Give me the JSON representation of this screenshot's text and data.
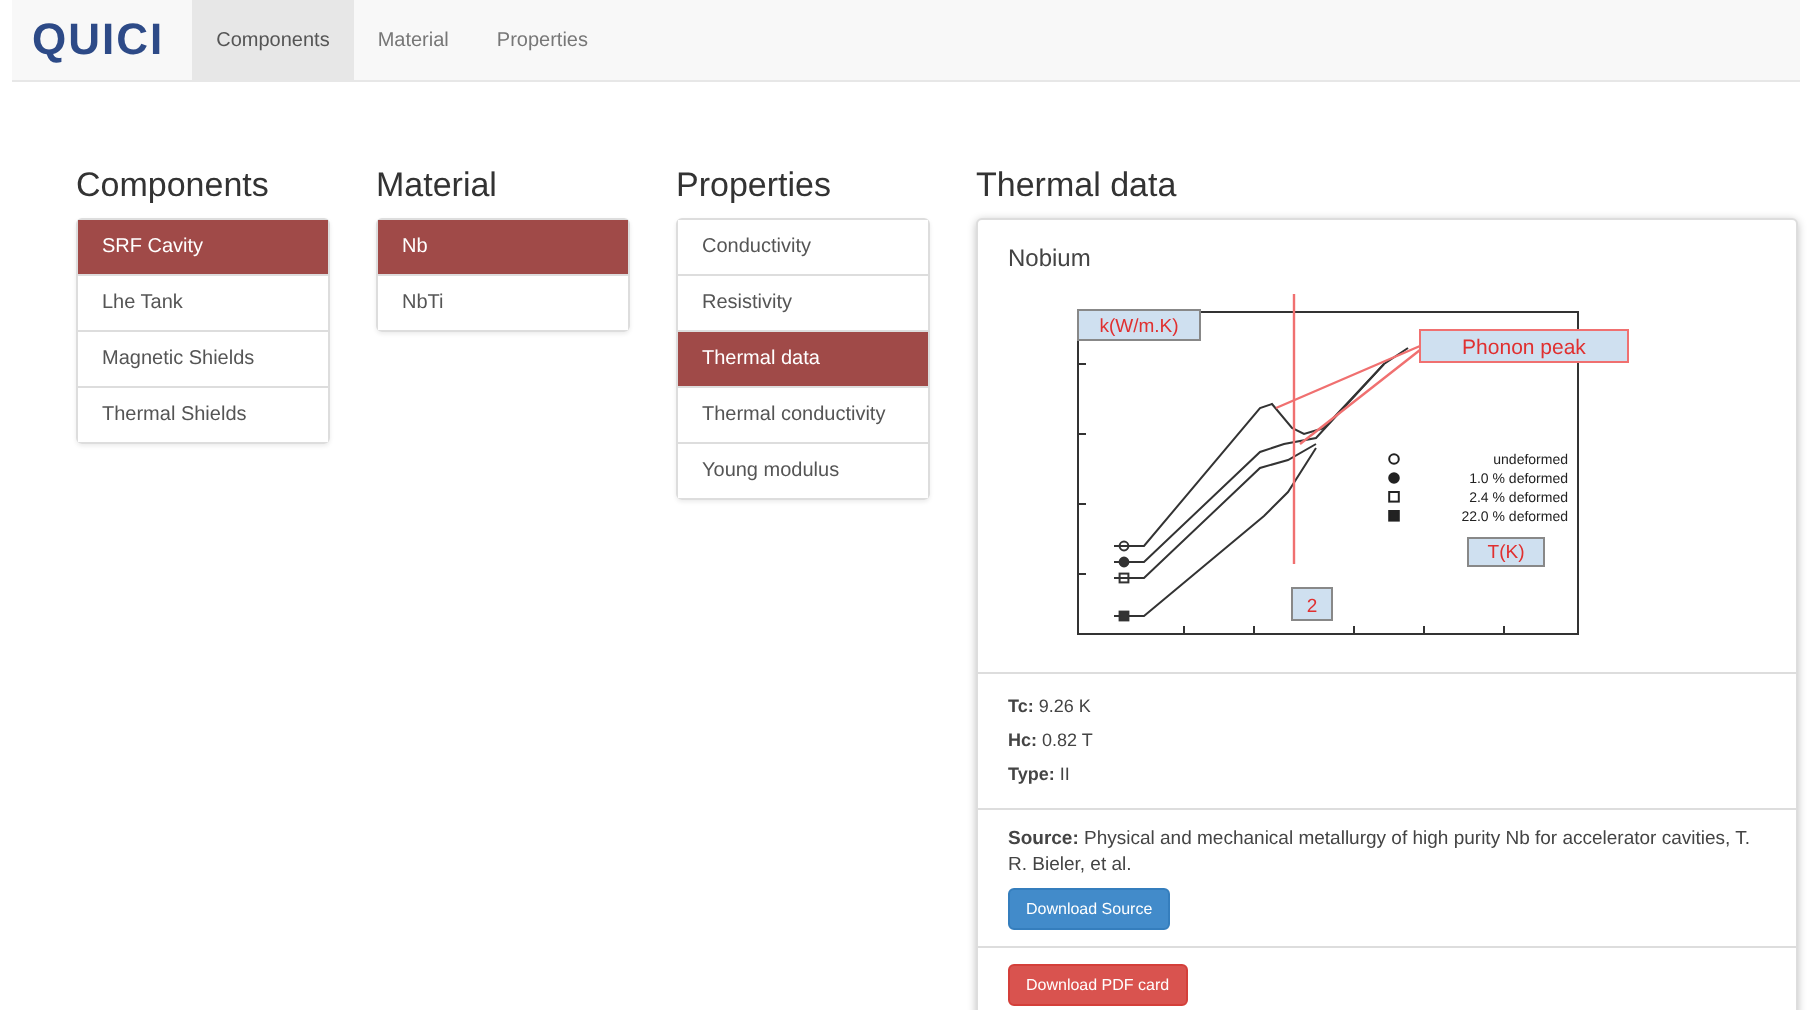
{
  "navbar": {
    "brand": "QUICI",
    "tabs": [
      {
        "label": "Components",
        "selected": true
      },
      {
        "label": "Material",
        "selected": false
      },
      {
        "label": "Properties",
        "selected": false
      }
    ]
  },
  "columns": [
    {
      "heading": "Components",
      "items": [
        {
          "label": "SRF Cavity",
          "selected": true
        },
        {
          "label": "Lhe Tank",
          "selected": false
        },
        {
          "label": "Magnetic Shields",
          "selected": false
        },
        {
          "label": "Thermal Shields",
          "selected": false
        }
      ]
    },
    {
      "heading": "Material",
      "items": [
        {
          "label": "Nb",
          "selected": true
        },
        {
          "label": "NbTi",
          "selected": false
        }
      ]
    },
    {
      "heading": "Properties",
      "items": [
        {
          "label": "Conductivity",
          "selected": false
        },
        {
          "label": "Resistivity",
          "selected": false
        },
        {
          "label": "Thermal data",
          "selected": true
        },
        {
          "label": "Thermal conductivity",
          "selected": false
        },
        {
          "label": "Young modulus",
          "selected": false
        }
      ]
    }
  ],
  "thermal": {
    "heading": "Thermal data",
    "title": "Nobium",
    "figure": {
      "annotations": [
        {
          "kind": "y-axis",
          "text": "k(W/m.K)"
        },
        {
          "kind": "peak",
          "text": "Phonon peak"
        },
        {
          "kind": "x-axis",
          "text": "T(K)"
        },
        {
          "kind": "marker",
          "text": "2"
        }
      ],
      "legend": [
        {
          "kind": "open-circle",
          "text": "undeformed"
        },
        {
          "kind": "filled-circle",
          "text": "1.0 % deformed"
        },
        {
          "kind": "open-square",
          "text": "2.4 % deformed"
        },
        {
          "kind": "filled-square",
          "text": "22.0 % deformed"
        }
      ]
    },
    "properties": [
      "**Tc:** 9.26 K",
      "**Hc:** 0.82 T",
      "**Type:** II"
    ],
    "source": "**Source:** Physical and mechanical metallurgy of high purity Nb for accelerator cavities, T. R. Bieler, et al.",
    "buttons": [
      {
        "kind": "primary",
        "label": "Download Source"
      },
      {
        "kind": "danger",
        "label": "Download PDF card"
      }
    ]
  }
}
